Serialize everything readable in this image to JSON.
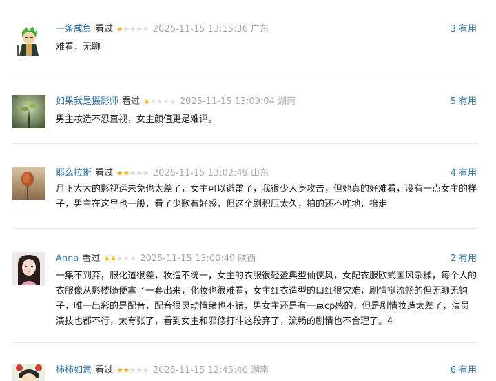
{
  "comments": [
    {
      "user": "一条咸鱼",
      "status": "看过",
      "rating": 1,
      "time": "2025-11-15 13:15:36",
      "location": "广东",
      "votes": "3",
      "useful_label": "有用",
      "text": "难看，无聊"
    },
    {
      "user": "如果我是摄影师",
      "status": "看过",
      "rating": 1,
      "time": "2025-11-15 13:09:04",
      "location": "湖南",
      "votes": "5",
      "useful_label": "有用",
      "text": "男主妆造不忍直视，女主颜值更是难评。"
    },
    {
      "user": "耶么拉斯",
      "status": "看过",
      "rating": 2,
      "time": "2025-11-15 13:02:49",
      "location": "山东",
      "votes": "4",
      "useful_label": "有用",
      "text": "月下大大的影视运未免也太差了，女主可以避雷了，我很少人身攻击，但她真的好难看，没有一点女主的样子，男主在这里也一般，看了少歌有好感，但这个剧积压太久，拍的还不咋地，抬走"
    },
    {
      "user": "Anna",
      "status": "看过",
      "rating": 2,
      "time": "2025-11-15 13:00:49",
      "location": "陕西",
      "votes": "2",
      "useful_label": "有用",
      "text": "一集不到弃，服化道很差，妆造不统一，女主的衣服很轻盈典型仙侠风，女配衣服欧式国风杂糅，每个人的衣服像从影楼随便拿了一套出来，化妆也很难看，女主红衣造型的口红很灾难，剧情挺流畅的但无聊无钩子，唯一出彩的是配音，配音很灵动情绪也不错，男女主还是有一点cp感的，但是剧情妆造太差了，演员演技也都不行，太夸张了，看到女主和邪修打斗这段弃了，流畅的剧情也不合理了。4"
    },
    {
      "user": "柿柿如意",
      "status": "看过",
      "rating": 2,
      "time": "2025-11-15 12:45:40",
      "location": "湖南",
      "votes": "6",
      "useful_label": "有用",
      "text": ""
    }
  ],
  "colors": {
    "link": "#3377aa",
    "star_on": "#f5b014",
    "star_off": "#dddddd",
    "meta_gray": "#aaaaaa"
  },
  "icons": [
    "star-icon"
  ]
}
